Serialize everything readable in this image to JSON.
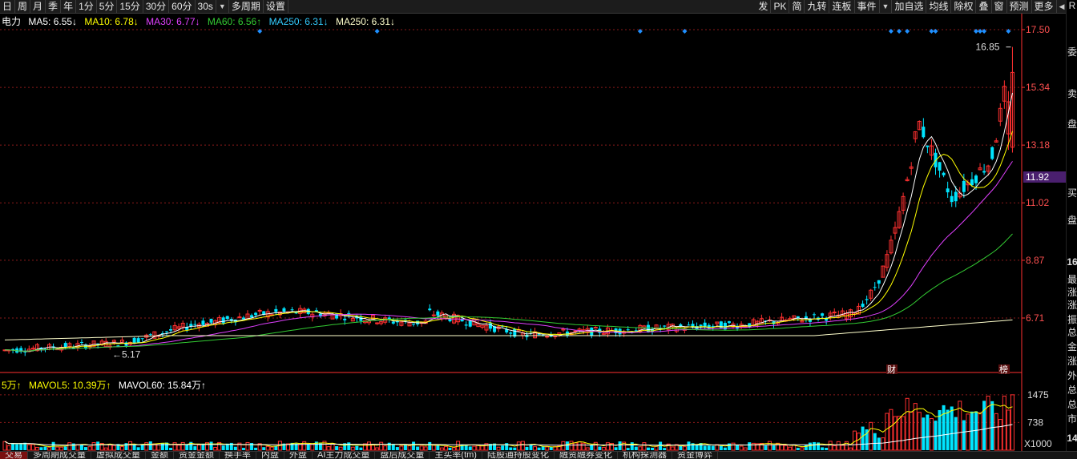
{
  "toolbar": {
    "left_items": [
      "日",
      "周",
      "月",
      "季",
      "年",
      "1分",
      "5分",
      "15分",
      "30分",
      "60分",
      "30s",
      "多周期",
      "设置"
    ],
    "right_items": [
      "发",
      "PK",
      "简",
      "九转",
      "连板",
      "事件",
      "加自选",
      "均线",
      "除权",
      "叠",
      "窗",
      "预测",
      "更多"
    ]
  },
  "indicator": {
    "name": "电力",
    "ma5": "MA5: 6.55↓",
    "ma10": "MA10: 6.78↓",
    "ma30": "MA30: 6.77↓",
    "ma60": "MA60: 6.56↑",
    "ma250a": "MA250: 6.31↓",
    "ma250b": "MA250: 6.31↓"
  },
  "colors": {
    "ma5": "#ffffff",
    "ma10": "#ffff00",
    "ma30": "#e040ff",
    "ma60": "#33cc33",
    "ma250a": "#33ccff",
    "ma250b": "#ffffcc",
    "up": "#ff3030",
    "down": "#00e5ff",
    "grid": "#8b1a1a",
    "axis": "#ff3030"
  },
  "price_axis": [
    "17.50",
    "15.34",
    "13.18",
    "11.02",
    "8.87",
    "6.71"
  ],
  "current_price": "11.92",
  "high_label": "16.85",
  "low_label": "5.17",
  "markers": [
    "财",
    "榜"
  ],
  "volume": {
    "vol_label": "5万↑",
    "mavol5": "MAVOL5: 10.39万↑",
    "mavol60": "MAVOL60: 15.84万↑",
    "axis": [
      "1475",
      "738"
    ],
    "unit": "X1000"
  },
  "side": {
    "top": "R",
    "labels": [
      "委",
      "卖",
      "盘",
      "买",
      "盘",
      "16",
      "最",
      "涨",
      "涨",
      "振",
      "总",
      "金",
      "涨",
      "外",
      "总",
      "总",
      "市",
      "14"
    ]
  },
  "bottom_tabs": [
    "交易",
    "多周期成交量",
    "虚拟成交量",
    "金额",
    "资金金额",
    "换手率",
    "内盘",
    "外盘",
    "AI主力成交量",
    "盘后成交量",
    "主买率(tm)",
    "陆股通持股变化",
    "融资融券变化",
    "机构探测器",
    "资金博弈"
  ],
  "chart_data": {
    "type": "candlestick",
    "x": [],
    "price_ticks": [
      17.5,
      15.34,
      13.18,
      11.02,
      8.87,
      6.71
    ],
    "ylim": [
      5.0,
      17.8
    ],
    "last_close": 11.92,
    "high": 16.85,
    "low": 5.17,
    "volume_ticks": [
      1475,
      738
    ]
  }
}
